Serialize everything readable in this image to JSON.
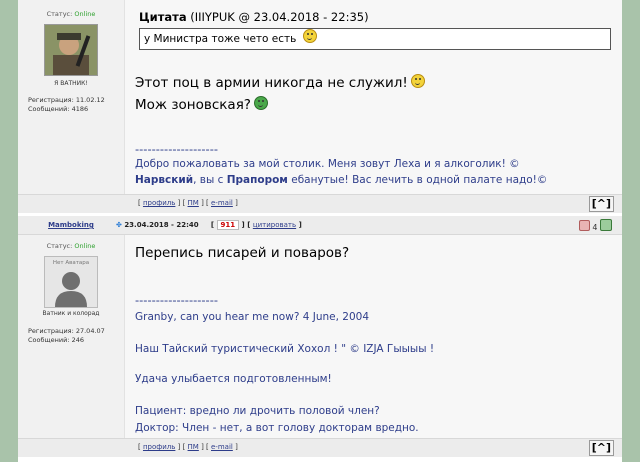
{
  "post1": {
    "status_label": "Статус:",
    "status_value": "Online",
    "avatar_caption": "Я ВАТНИК!",
    "registered": "Регистрация: 11.02.12",
    "messages": "Сообщений: 4186",
    "quote_label": "Цитата",
    "quote_meta": "(IIIYPUK @ 23.04.2018 - 22:35)",
    "quote_text": "у Министра тоже чето есть",
    "message_line1": "Этот поц в армии никогда не служил!",
    "message_line2": "Мож зоновская?",
    "dashes": "--------------------",
    "sig_line1": "Добро пожаловать за мой столик. Меня зовут Леха и я алкоголик! ©",
    "sig_name1": "Нарвский",
    "sig_mid": ", вы с ",
    "sig_name2": "Прапором",
    "sig_end": " ебанутые! Вас лечить в одной палате надо!©",
    "footer_profile": "профиль",
    "footer_pm": "ПМ",
    "footer_email": "e-mail",
    "up_button": "[^]"
  },
  "post2": {
    "username": "Mamboking",
    "date": "23.04.2018 - 22:40",
    "rating": "911",
    "quote_link": "цитировать",
    "votes": "4",
    "status_label": "Статус:",
    "status_value": "Online",
    "no_avatar": "Нет Аватара",
    "avatar_caption": "Ватник и колорад",
    "registered": "Регистрация: 27.04.07",
    "messages": "Сообщений: 246",
    "message": "Перепись писарей и поваров?",
    "dashes": "--------------------",
    "sig_line1": "Granby, can you hear me now? 4 June, 2004",
    "sig_line2": "Наш Тайский туристический Хохол ! \" © IZJA Гыыыы !",
    "sig_line3": "Удача улыбается подготовленным!",
    "sig_line4": "Пациент: вредно ли дрочить половой член?",
    "sig_line5": "Доктор: Член - нет, а вот голову докторам вредно.",
    "footer_profile": "профиль",
    "footer_pm": "ПМ",
    "footer_email": "e-mail",
    "up_button": "[^]"
  },
  "colors": {
    "link": "#2e3d8a",
    "online": "#2fa12f",
    "rating": "#cc0000",
    "background": "#a9c3aa"
  }
}
